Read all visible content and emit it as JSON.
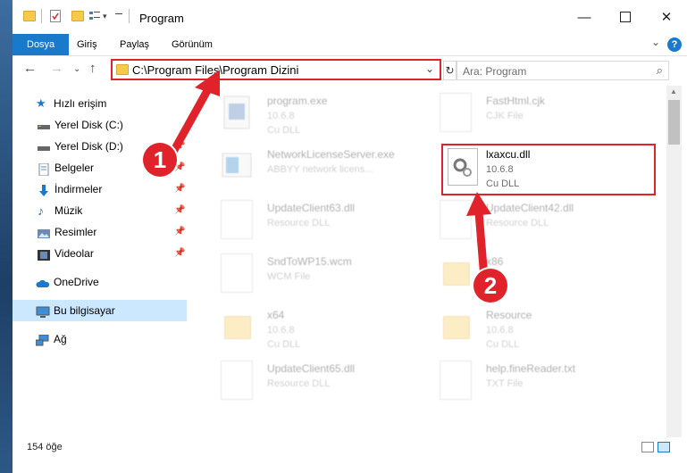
{
  "window": {
    "title": "Program"
  },
  "ribbon": {
    "tabs": [
      "Dosya",
      "Giriş",
      "Paylaş",
      "Görünüm"
    ]
  },
  "address": {
    "path": "C:\\Program Files\\Program Dizini"
  },
  "search": {
    "placeholder": "Ara: Program"
  },
  "sidebar": {
    "items": [
      {
        "label": "Hızlı erişim",
        "icon": "star-icon"
      },
      {
        "label": "Yerel Disk (C:)",
        "icon": "drive-icon"
      },
      {
        "label": "Yerel Disk (D:)",
        "icon": "drive-icon"
      },
      {
        "label": "Belgeler",
        "icon": "documents-icon"
      },
      {
        "label": "İndirmeler",
        "icon": "download-icon"
      },
      {
        "label": "Müzik",
        "icon": "music-icon"
      },
      {
        "label": "Resimler",
        "icon": "pictures-icon"
      },
      {
        "label": "Videolar",
        "icon": "videos-icon"
      },
      {
        "label": "OneDrive",
        "icon": "cloud-icon"
      },
      {
        "label": "Bu bilgisayar",
        "icon": "computer-icon"
      },
      {
        "label": "Ağ",
        "icon": "network-icon"
      }
    ]
  },
  "files": {
    "items": [
      {
        "name": "program.exe",
        "line2": "10.6.8",
        "line3": "Cu DLL"
      },
      {
        "name": "FastHtml.cjk",
        "line2": "CJK File",
        "line3": ""
      },
      {
        "name": "NetworkLicenseServer.exe",
        "line2": "ABBYY network licens...",
        "line3": ""
      },
      {
        "name": "lxaxcu.dll",
        "line2": "10.6.8",
        "line3": "Cu DLL"
      },
      {
        "name": "UpdateClient63.dll",
        "line2": "Resource DLL",
        "line3": ""
      },
      {
        "name": "UpdateClient42.dll",
        "line2": "Resource DLL",
        "line3": ""
      },
      {
        "name": "SndToWP15.wcm",
        "line2": "WCM File",
        "line3": ""
      },
      {
        "name": "x86",
        "line2": "",
        "line3": ""
      },
      {
        "name": "x64",
        "line2": "10.6.8",
        "line3": "Cu DLL"
      },
      {
        "name": "Resource",
        "line2": "10.6.8",
        "line3": "Cu DLL"
      },
      {
        "name": "UpdateClient65.dll",
        "line2": "Resource DLL",
        "line3": ""
      },
      {
        "name": "help.fineReader.txt",
        "line2": "TXT File",
        "line3": ""
      }
    ]
  },
  "status": {
    "count": "154 öğe"
  },
  "annotations": {
    "step1": "1",
    "step2": "2"
  },
  "colors": {
    "accent": "#1979ca",
    "highlight": "#e0232b",
    "selected": "#cce8ff"
  }
}
